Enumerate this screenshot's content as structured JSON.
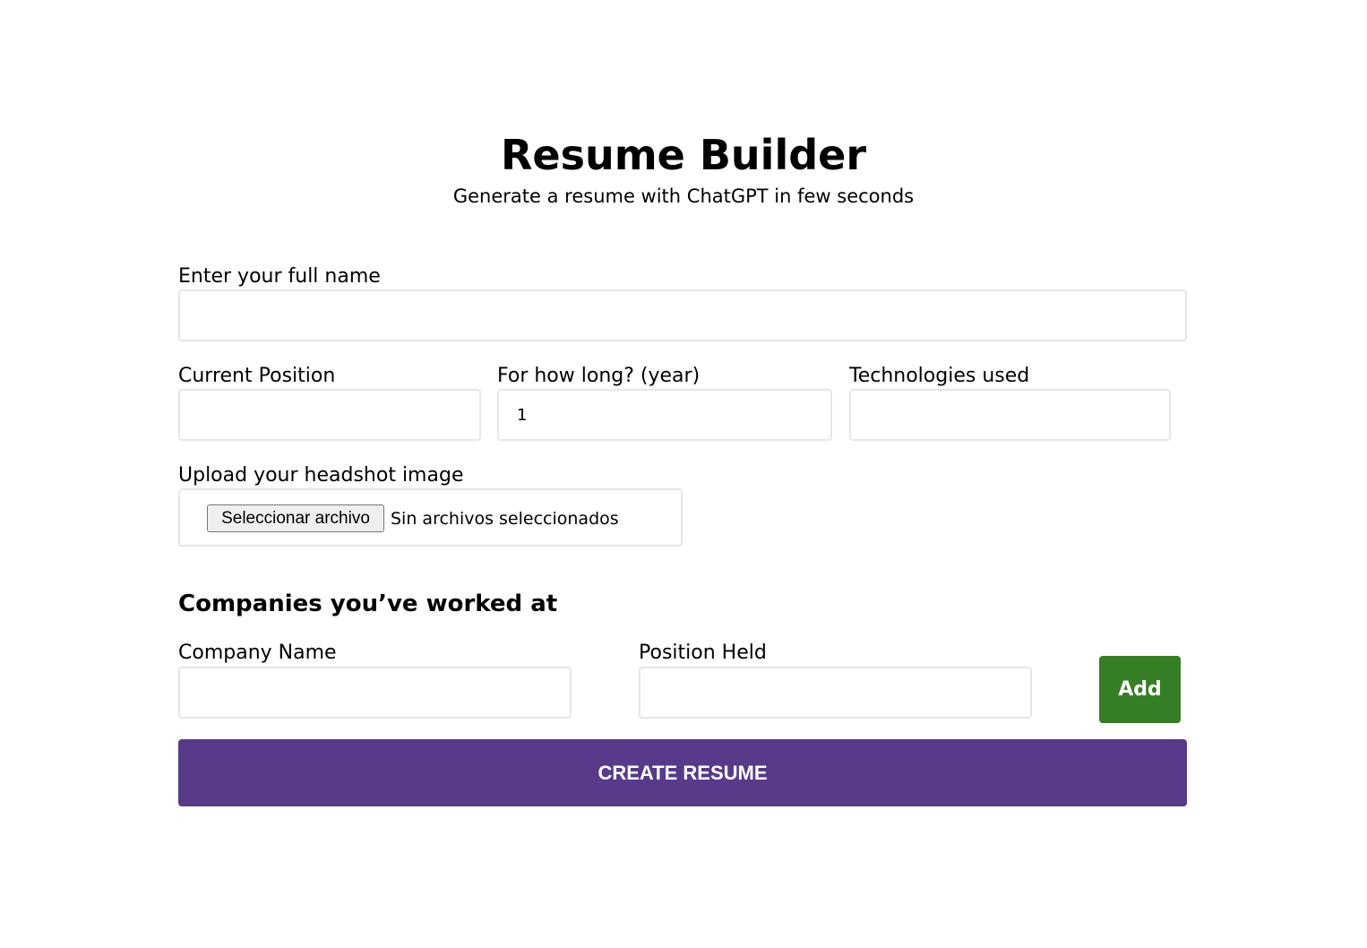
{
  "header": {
    "title": "Resume Builder",
    "subtitle": "Generate a resume with ChatGPT in few seconds"
  },
  "form": {
    "full_name": {
      "label": "Enter your full name",
      "value": ""
    },
    "current_position": {
      "label": "Current Position",
      "value": ""
    },
    "years": {
      "label": "For how long? (year)",
      "value": "1"
    },
    "technologies": {
      "label": "Technologies used",
      "value": ""
    },
    "headshot": {
      "label": "Upload your headshot image",
      "button_label": "Seleccionar archivo",
      "status": "Sin archivos seleccionados"
    }
  },
  "companies": {
    "heading": "Companies you’ve worked at",
    "company_name": {
      "label": "Company Name",
      "value": ""
    },
    "position_held": {
      "label": "Position Held",
      "value": ""
    },
    "add_label": "Add"
  },
  "actions": {
    "create_label": "CREATE RESUME"
  },
  "colors": {
    "add_button": "#367e25",
    "create_button": "#573b8a",
    "input_border": "#e6e6e6"
  }
}
